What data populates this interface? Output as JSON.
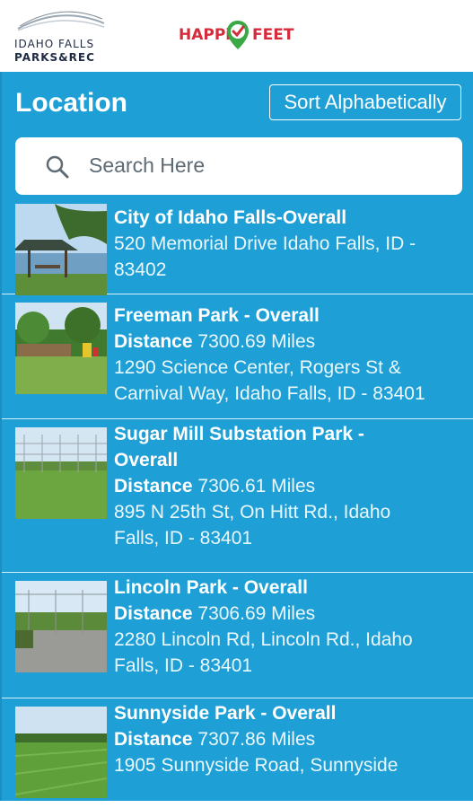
{
  "header": {
    "idaho_logo_line1": "IDAHO FALLS",
    "idaho_logo_line2": "PARKS&REC",
    "happi_left": "HAPPi",
    "happi_right": "FEET"
  },
  "panel": {
    "title": "Location",
    "sort_label": "Sort Alphabetically",
    "search_placeholder": "Search Here"
  },
  "locations": [
    {
      "name": "City of Idaho Falls-Overall",
      "address_line1": "520 Memorial Drive Idaho Falls, ID -",
      "address_line2": "83402"
    },
    {
      "name": "Freeman Park - Overall",
      "distance_label": "Distance",
      "distance": "7300.69 Miles",
      "address_line1": "1290 Science Center, Rogers St &",
      "address_line2": "Carnival Way, Idaho Falls, ID - 83401"
    },
    {
      "name_line1": "Sugar Mill Substation Park -",
      "name_line2": "Overall",
      "distance_label": "Distance",
      "distance": "7306.61 Miles",
      "address_line1": "895 N 25th St, On Hitt Rd., Idaho",
      "address_line2": "Falls, ID - 83401"
    },
    {
      "name": "Lincoln Park - Overall",
      "distance_label": "Distance",
      "distance": "7306.69 Miles",
      "address_line1": "2280 Lincoln Rd, Lincoln Rd., Idaho",
      "address_line2": "Falls, ID - 83401"
    },
    {
      "name": "Sunnyside Park - Overall",
      "distance_label": "Distance",
      "distance": "7307.86 Miles",
      "address_line1": "1905 Sunnyside Road, Sunnyside"
    }
  ],
  "colors": {
    "panel_bg": "#1ea0d7",
    "brand_red": "#d62b3a",
    "brand_green": "#3aa845"
  }
}
